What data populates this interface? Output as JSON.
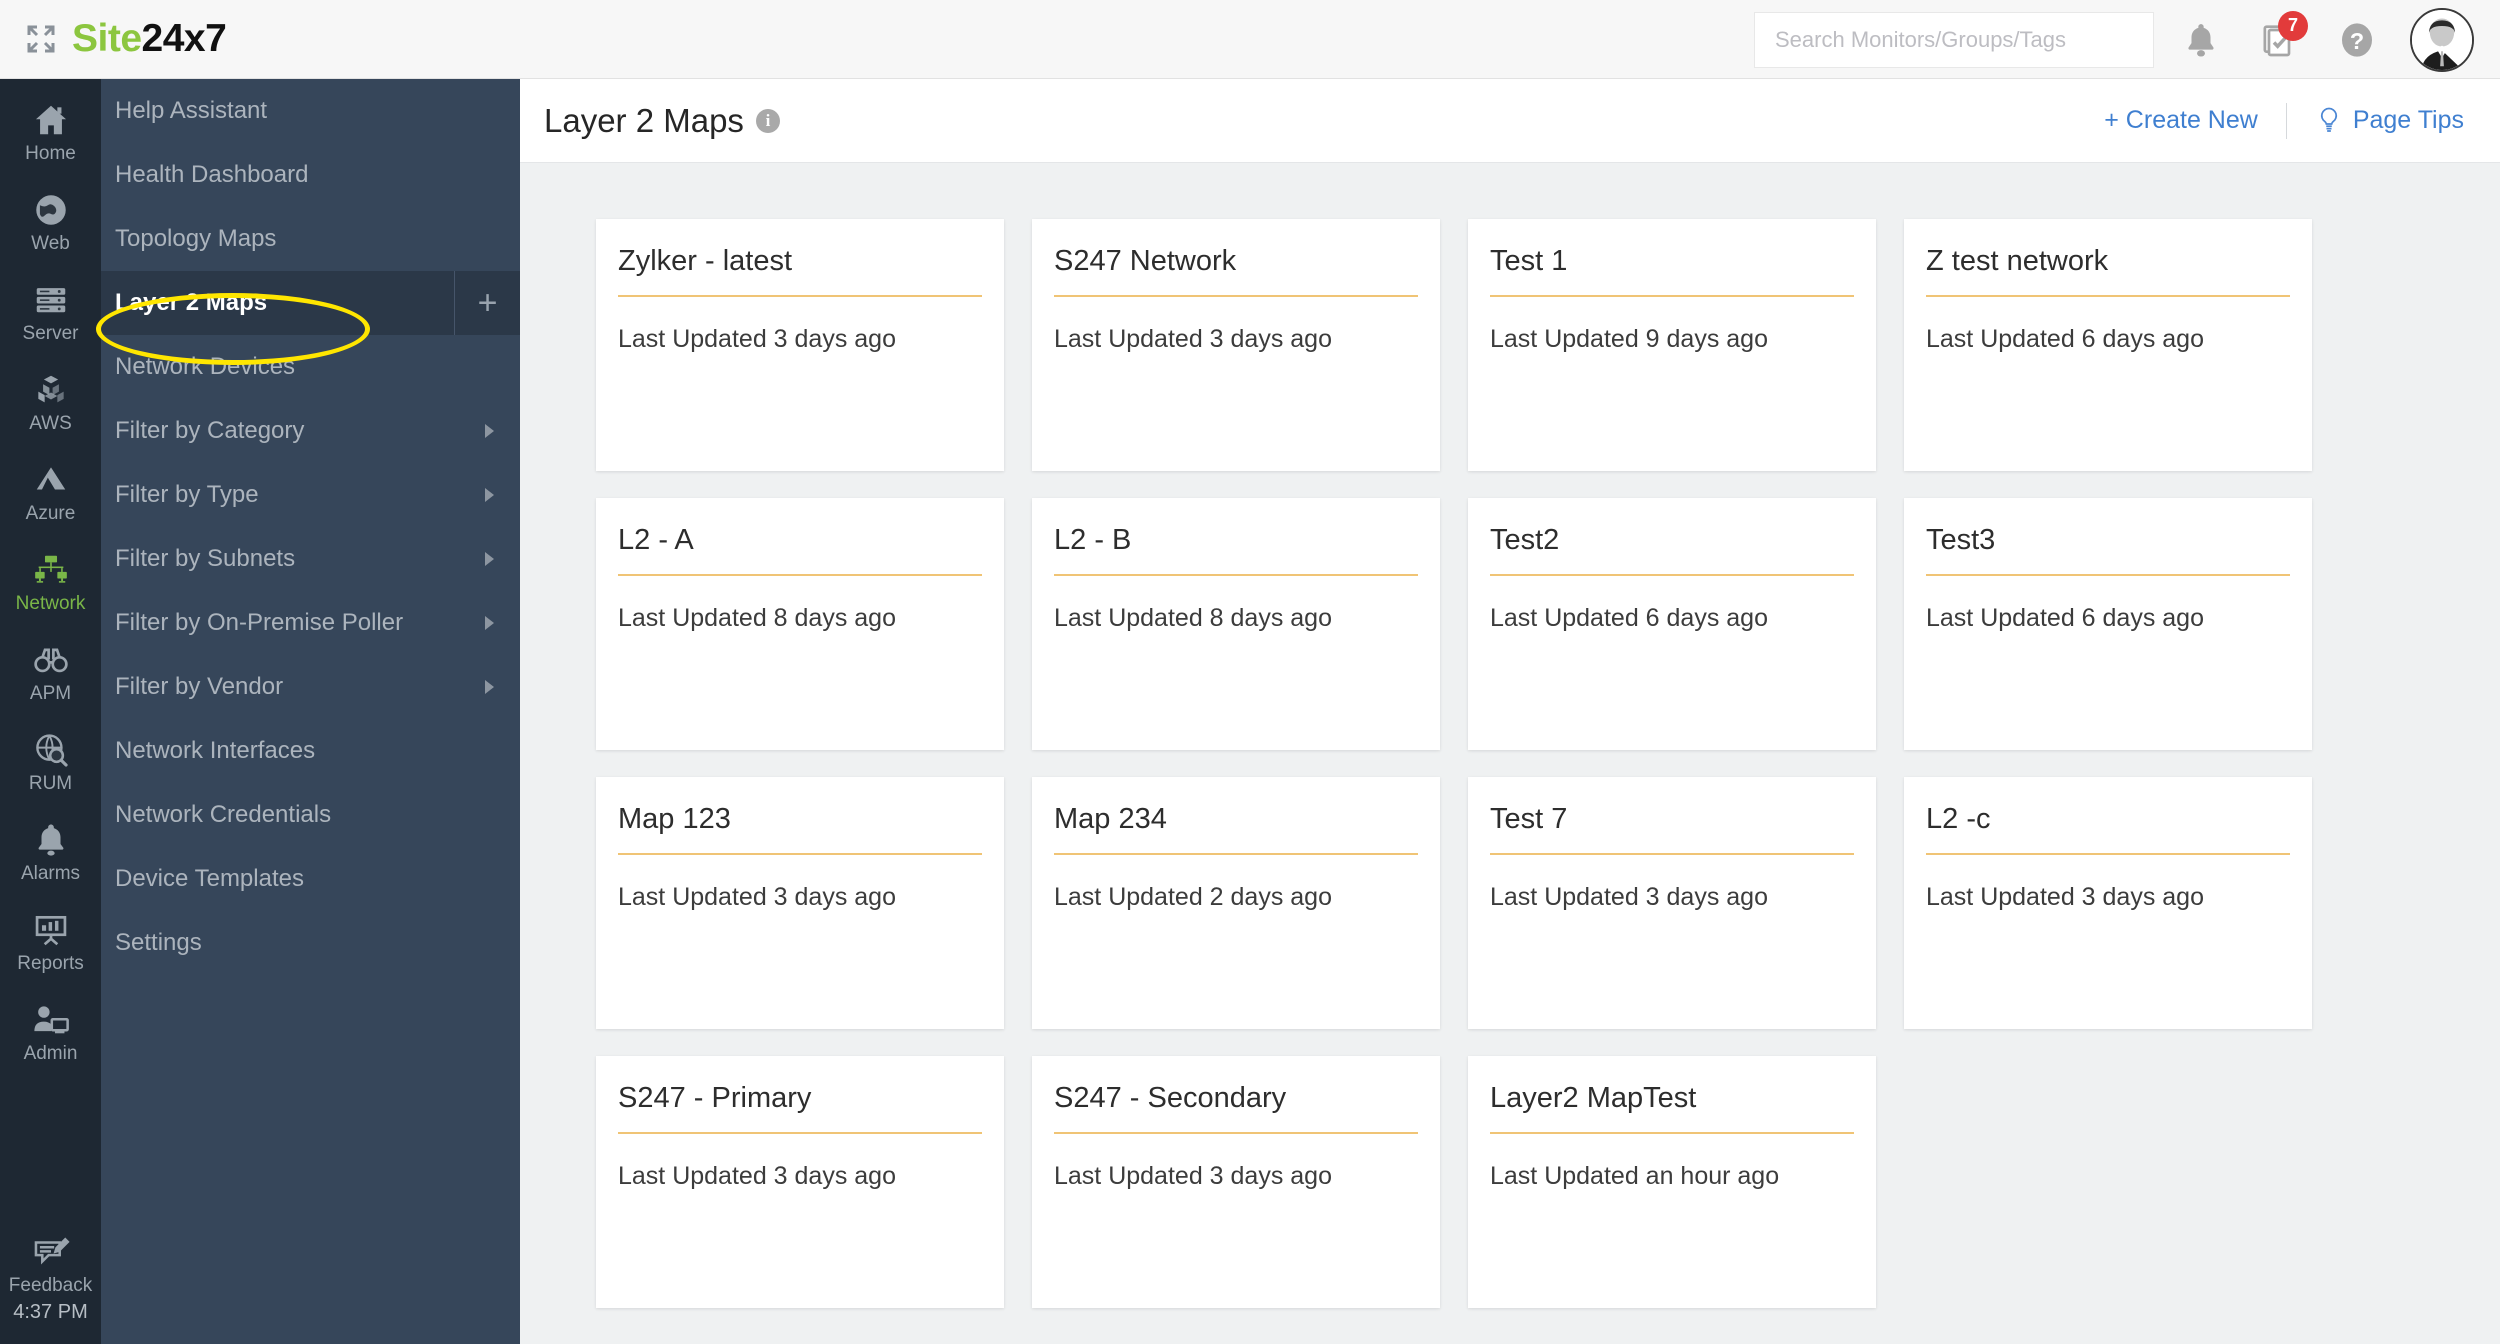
{
  "brand": {
    "name_green": "Site",
    "name_dark": "24x7",
    "expand_icon": "expand-icon"
  },
  "topbar": {
    "search": {
      "placeholder": "Search Monitors/Groups/Tags",
      "value": ""
    },
    "icons": [
      {
        "name": "bell-icon",
        "label": "Notifications"
      },
      {
        "name": "checklist-icon",
        "label": "Tasks",
        "badge": "7"
      },
      {
        "name": "help-icon",
        "label": "Help"
      }
    ],
    "avatar": "user-avatar"
  },
  "rail": {
    "items": [
      {
        "label": "Home",
        "icon": "home-icon",
        "active": false
      },
      {
        "label": "Web",
        "icon": "globe-icon",
        "active": false
      },
      {
        "label": "Server",
        "icon": "server-icon",
        "active": false
      },
      {
        "label": "AWS",
        "icon": "aws-icon",
        "active": false
      },
      {
        "label": "Azure",
        "icon": "azure-icon",
        "active": false
      },
      {
        "label": "Network",
        "icon": "network-icon",
        "active": true
      },
      {
        "label": "APM",
        "icon": "binoculars-icon",
        "active": false
      },
      {
        "label": "RUM",
        "icon": "rum-icon",
        "active": false
      },
      {
        "label": "Alarms",
        "icon": "bell-icon",
        "active": false
      },
      {
        "label": "Reports",
        "icon": "reports-icon",
        "active": false
      },
      {
        "label": "Admin",
        "icon": "admin-icon",
        "active": false
      }
    ],
    "feedback": {
      "label": "Feedback",
      "icon": "feedback-icon"
    },
    "clock": "4:37 PM",
    "active_color": "#7ab648"
  },
  "subnav": {
    "items": [
      {
        "label": "Help Assistant",
        "active": false,
        "expandable": false,
        "add": false
      },
      {
        "label": "Health Dashboard",
        "active": false,
        "expandable": false,
        "add": false
      },
      {
        "label": "Topology Maps",
        "active": false,
        "expandable": false,
        "add": false
      },
      {
        "label": "Layer 2 Maps",
        "active": true,
        "expandable": false,
        "add": true
      },
      {
        "label": "Network Devices",
        "active": false,
        "expandable": false,
        "add": false
      },
      {
        "label": "Filter by Category",
        "active": false,
        "expandable": true,
        "add": false
      },
      {
        "label": "Filter by Type",
        "active": false,
        "expandable": true,
        "add": false
      },
      {
        "label": "Filter by Subnets",
        "active": false,
        "expandable": true,
        "add": false
      },
      {
        "label": "Filter by On-Premise Poller",
        "active": false,
        "expandable": true,
        "add": false
      },
      {
        "label": "Filter by Vendor",
        "active": false,
        "expandable": true,
        "add": false
      },
      {
        "label": "Network Interfaces",
        "active": false,
        "expandable": false,
        "add": false
      },
      {
        "label": "Network Credentials",
        "active": false,
        "expandable": false,
        "add": false
      },
      {
        "label": "Device Templates",
        "active": false,
        "expandable": false,
        "add": false
      },
      {
        "label": "Settings",
        "active": false,
        "expandable": false,
        "add": false
      }
    ],
    "add_button_label": "+"
  },
  "annotation": {
    "type": "ellipse-highlight",
    "target": "Layer 2 Maps",
    "color": "#ffe600"
  },
  "page": {
    "title": "Layer 2 Maps",
    "info_tooltip": "i",
    "create_new_label": "+ Create New",
    "page_tips_label": "Page Tips"
  },
  "maps": [
    {
      "title": "Zylker - latest",
      "updated": "Last Updated 3 days ago"
    },
    {
      "title": "S247 Network",
      "updated": "Last Updated 3 days ago"
    },
    {
      "title": "Test 1",
      "updated": "Last Updated 9 days ago"
    },
    {
      "title": "Z test network",
      "updated": "Last Updated 6 days ago"
    },
    {
      "title": "L2 - A",
      "updated": "Last Updated 8 days ago"
    },
    {
      "title": "L2 - B",
      "updated": "Last Updated 8 days ago"
    },
    {
      "title": "Test2",
      "updated": "Last Updated 6 days ago"
    },
    {
      "title": "Test3",
      "updated": "Last Updated 6 days ago"
    },
    {
      "title": "Map 123",
      "updated": "Last Updated 3 days ago"
    },
    {
      "title": "Map 234",
      "updated": "Last Updated 2 days ago"
    },
    {
      "title": "Test 7",
      "updated": "Last Updated 3 days ago"
    },
    {
      "title": "L2 -c",
      "updated": "Last Updated 3 days ago"
    },
    {
      "title": "S247 - Primary",
      "updated": "Last Updated 3 days ago"
    },
    {
      "title": "S247 - Secondary",
      "updated": "Last Updated 3 days ago"
    },
    {
      "title": "Layer2 MapTest",
      "updated": "Last Updated an hour ago"
    }
  ],
  "colors": {
    "brand_green": "#8cc63f",
    "rail_bg": "#1e2833",
    "subnav_bg": "#36465a",
    "subnav_active_bg": "#2b3848",
    "content_bg": "#eff1f2",
    "card_rule": "#f0c475",
    "link_blue": "#3f7fd0",
    "badge_red": "#e23b3b"
  }
}
